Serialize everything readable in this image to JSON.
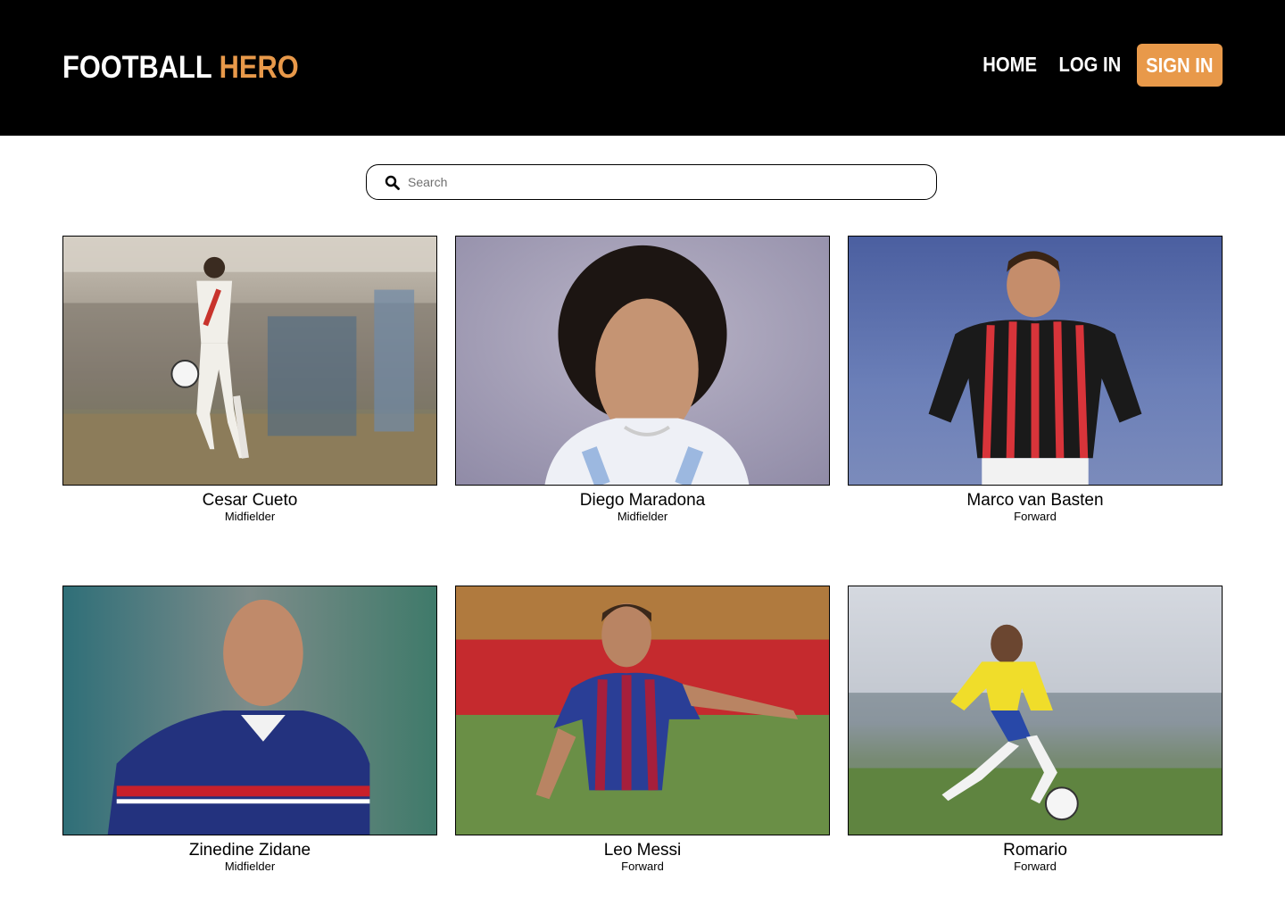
{
  "header": {
    "logo_main": "FOOTBALL",
    "logo_accent": "HERO",
    "accent_color": "#e8994a",
    "nav": {
      "home": "HOME",
      "login": "LOG IN",
      "signin": "SIGN IN"
    }
  },
  "search": {
    "placeholder": "Search",
    "icon": "search-icon"
  },
  "players": [
    {
      "name": "Cesar Cueto",
      "position": "Midfielder"
    },
    {
      "name": "Diego Maradona",
      "position": "Midfielder"
    },
    {
      "name": "Marco van Basten",
      "position": "Forward"
    },
    {
      "name": "Zinedine Zidane",
      "position": "Midfielder"
    },
    {
      "name": "Leo Messi",
      "position": "Forward"
    },
    {
      "name": "Romario",
      "position": "Forward"
    }
  ]
}
